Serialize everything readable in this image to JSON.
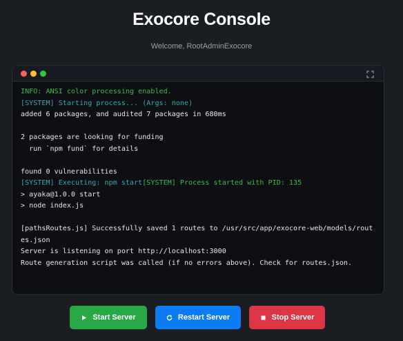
{
  "header": {
    "title": "Exocore Console",
    "welcome": "Welcome, RootAdminExocore"
  },
  "console": {
    "window_dots": [
      "red-dot-icon",
      "yellow-dot-icon",
      "green-dot-icon"
    ],
    "expand_icon": "expand-icon",
    "lines": [
      {
        "text": "INFO: ANSI color processing enabled.",
        "color": "green"
      },
      {
        "text": "[SYSTEM] Starting process... (Args: none)",
        "color": "cyan"
      },
      {
        "text": "added 6 packages, and audited 7 packages in 680ms",
        "color": "default"
      },
      {
        "text": "",
        "color": "default"
      },
      {
        "text": "2 packages are looking for funding",
        "color": "default"
      },
      {
        "text": "  run `npm fund` for details",
        "color": "default"
      },
      {
        "text": "",
        "color": "default"
      },
      {
        "text": "found 0 vulnerabilities",
        "color": "default"
      },
      {
        "text": "[SYSTEM] Executing: npm start",
        "color": "cyan",
        "continuation": {
          "text": "[SYSTEM] Process started with PID: 135",
          "color": "green"
        }
      },
      {
        "text": "> ayaka@1.0.0 start",
        "color": "default"
      },
      {
        "text": "> node index.js",
        "color": "default"
      },
      {
        "text": "",
        "color": "default"
      },
      {
        "text": "[pathsRoutes.js] Successfully saved 1 routes to /usr/src/app/exocore-web/models/routes.json",
        "color": "default"
      },
      {
        "text": "Server is listening on port http://localhost:3000",
        "color": "default"
      },
      {
        "text": "Route generation script was called (if no errors above). Check for routes.json.",
        "color": "default"
      }
    ]
  },
  "buttons": {
    "start": {
      "label": "Start Server",
      "icon": "play-icon",
      "color": "#28a745"
    },
    "restart": {
      "label": "Restart Server",
      "icon": "refresh-icon",
      "color": "#0d7cf2"
    },
    "stop": {
      "label": "Stop Server",
      "icon": "stop-icon",
      "color": "#dc3545"
    }
  }
}
